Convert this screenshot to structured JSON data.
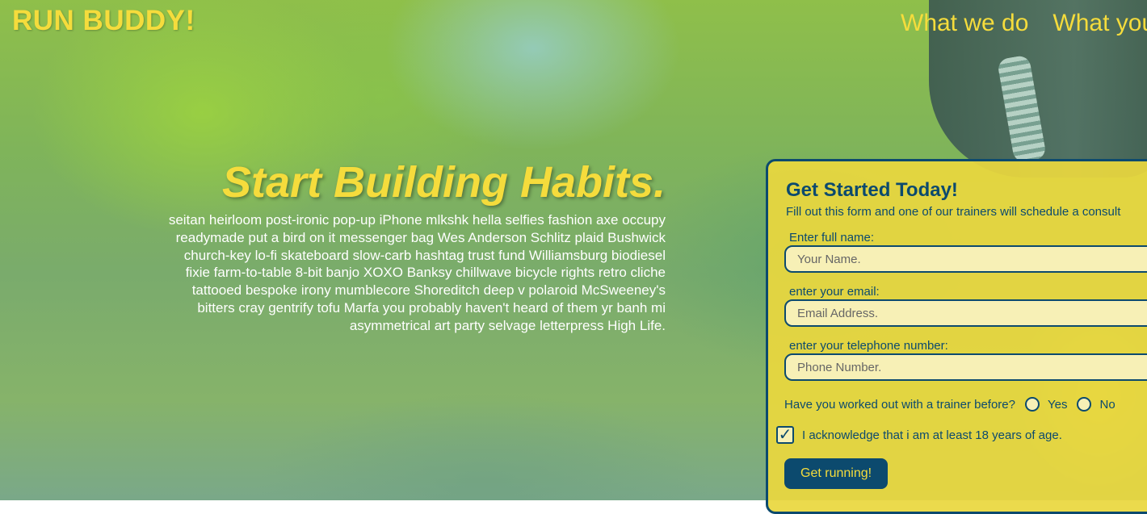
{
  "header": {
    "logo": "RUN BUDDY!",
    "nav": [
      "What we do",
      "What you"
    ]
  },
  "hero": {
    "title": "Start Building Habits.",
    "body": "seitan heirloom post-ironic pop-up iPhone mlkshk hella selfies fashion axe occupy readymade put a bird on it messenger bag Wes Anderson Schlitz plaid Bushwick church-key lo-fi skateboard slow-carb hashtag trust fund Williamsburg biodiesel fixie farm-to-table 8-bit banjo XOXO Banksy chillwave bicycle rights retro cliche tattooed bespoke irony mumblecore Shoreditch deep v polaroid McSweeney's bitters cray gentrify tofu Marfa you probably haven't heard of them yr banh mi asymmetrical art party selvage letterpress High Life."
  },
  "form": {
    "title": "Get Started Today!",
    "subtitle": "Fill out this form and one of our trainers will schedule a consult",
    "name_label": "Enter full name:",
    "name_placeholder": "Your Name.",
    "email_label": "enter your email:",
    "email_placeholder": "Email Address.",
    "phone_label": "enter your telephone number:",
    "phone_placeholder": "Phone Number.",
    "trainer_question": "Have you worked out with a trainer before?",
    "yes_label": "Yes",
    "no_label": "No",
    "age_ack": "I acknowledge that i am at least 18 years of age.",
    "age_ack_checked": true,
    "submit_label": "Get running!"
  },
  "colors": {
    "accent_yellow": "#f5dc3c",
    "navy": "#0c4a6e",
    "form_bg": "#e9d73e"
  }
}
